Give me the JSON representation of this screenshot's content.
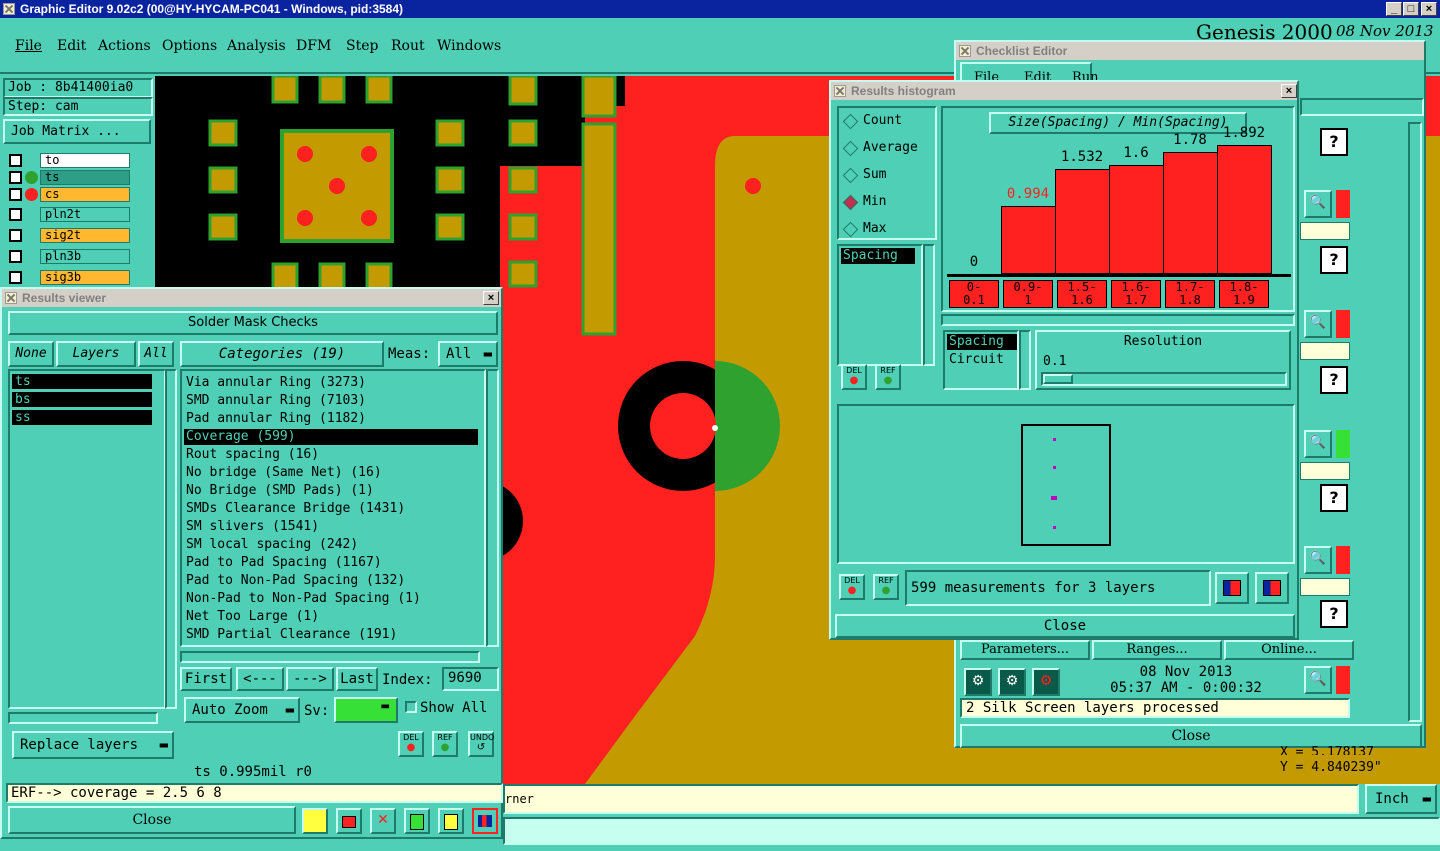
{
  "app": {
    "title": "Graphic Editor 9.02c2 (00@HY-HYCAM-PC041 - Windows, pid:3584)",
    "brand": "Genesis 2000",
    "date": "08 Nov 2013",
    "menu": [
      "File",
      "Edit",
      "Actions",
      "Options",
      "Analysis",
      "DFM",
      "Step",
      "Rout",
      "Windows"
    ]
  },
  "job": {
    "job_label": "Job : 8b41400ia0",
    "step_label": "Step: cam",
    "matrix_button": "Job Matrix ..."
  },
  "layers": [
    {
      "name": "to",
      "color": "#ffffff"
    },
    {
      "name": "ts",
      "color": "#2e9e86"
    },
    {
      "name": "cs",
      "color": "#ffb830"
    },
    {
      "name": "pln2t",
      "color": "#4fcfb5"
    },
    {
      "name": "sig2t",
      "color": "#ffb830"
    },
    {
      "name": "pln3b",
      "color": "#4fcfb5"
    },
    {
      "name": "sig3b",
      "color": "#ffb830"
    }
  ],
  "results_viewer": {
    "title": "Results viewer",
    "header": "Solder Mask Checks",
    "none_btn": "None",
    "layers_btn": "Layers",
    "all_btn": "All",
    "categories_btn": "Categories (19)",
    "meas_label": "Meas:",
    "meas_value": "All",
    "layer_list": [
      "ts",
      "bs",
      "ss"
    ],
    "categories": [
      "Via annular Ring (3273)",
      "SMD annular Ring (7103)",
      "Pad annular Ring (1182)",
      "Coverage (599)",
      "Rout spacing (16)",
      "No bridge (Same Net) (16)",
      "No Bridge (SMD Pads) (1)",
      "SMDs Clearance Bridge (1431)",
      "SM slivers (1541)",
      "SM local spacing (242)",
      "Pad to Pad Spacing (1167)",
      "Pad to Non-Pad Spacing (132)",
      "Non-Pad to Non-Pad Spacing (1)",
      "Net Too Large (1)",
      "SMD Partial Clearance (191)"
    ],
    "first_btn": "First",
    "prev_btn": "<---",
    "next_btn": "--->",
    "last_btn": "Last",
    "index_label": "Index:",
    "index_value": "9690",
    "auto_zoom": "Auto Zoom",
    "sv_label": "Sv:",
    "show_all": "Show All",
    "replace_layers": "Replace layers",
    "status": "ts 0.995mil  r0",
    "erf": "ERF--> coverage = 2.5 6 8",
    "close": "Close",
    "del": "DEL",
    "ref": "REF",
    "undo": "UNDO"
  },
  "histogram": {
    "title": "Results histogram",
    "options": [
      "Count",
      "Average",
      "Sum",
      "Min",
      "Max"
    ],
    "selected_option": "Min",
    "param_list": [
      "Spacing"
    ],
    "params2": [
      "Spacing",
      "Circuit"
    ],
    "resolution_label": "Resolution",
    "resolution_value": "0.1",
    "summary": "599 measurements for 3 layers",
    "close": "Close",
    "del": "DEL",
    "ref": "REF"
  },
  "chart_data": {
    "type": "bar",
    "title": "Size(Spacing) / Min(Spacing)",
    "categories": [
      "0-\n0.1",
      "0.9-\n1",
      "1.5-\n1.6",
      "1.6-\n1.7",
      "1.7-\n1.8",
      "1.8-\n1.9"
    ],
    "values": [
      0,
      0.994,
      1.532,
      1.6,
      1.78,
      1.892
    ],
    "labels": [
      "0",
      "0.994",
      "1.532",
      "1.6",
      "1.78",
      "1.892"
    ],
    "ylim": [
      0,
      2.05
    ],
    "highlight_label_color": "#ff2020"
  },
  "checklist": {
    "title": "Checklist Editor",
    "menu": [
      "File",
      "Edit",
      "Run"
    ],
    "parameters": "Parameters...",
    "ranges": "Ranges...",
    "online": "Online...",
    "date": "08 Nov 2013",
    "time": "05:37 AM - 0:00:32",
    "status": "2 Silk Screen layers processed",
    "close": "Close"
  },
  "coords": {
    "x": "X = 5.178137",
    "y": "Y = 4.840239\""
  },
  "bottom": {
    "corner_text": "rner",
    "unit": "Inch"
  },
  "colors": {
    "panel": "#4fcfb5",
    "pcb_red": "#ff2020",
    "pcb_gold": "#c39a00",
    "pcb_green": "#2ea12e"
  }
}
